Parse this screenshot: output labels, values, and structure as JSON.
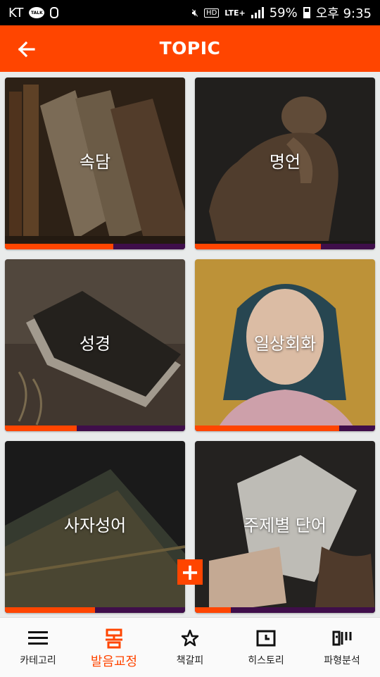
{
  "status_bar": {
    "carrier": "KT",
    "talk_badge": "TALK",
    "network": "LTE+",
    "hd": "HD",
    "battery": "59%",
    "time": "오후 9:35"
  },
  "header": {
    "title": "TOPIC",
    "back_icon": "arrow-left-icon"
  },
  "topics": [
    {
      "label": "속담",
      "progress": 0.6
    },
    {
      "label": "명언",
      "progress": 0.7
    },
    {
      "label": "성경",
      "progress": 0.4
    },
    {
      "label": "일상회화",
      "progress": 0.8
    },
    {
      "label": "사자성어",
      "progress": 0.5
    },
    {
      "label": "주제별 단어",
      "progress": 0.2
    }
  ],
  "fab": {
    "label": "+"
  },
  "bottom_nav": [
    {
      "label": "카테고리",
      "icon": "menu-icon"
    },
    {
      "label": "발음교정",
      "icon": "pronunciation-icon",
      "active": true
    },
    {
      "label": "책갈피",
      "icon": "star-icon"
    },
    {
      "label": "히스토리",
      "icon": "history-icon"
    },
    {
      "label": "파형분석",
      "icon": "waveform-icon"
    }
  ],
  "colors": {
    "accent": "#ff4500",
    "progress_track": "#3f0e4a"
  }
}
